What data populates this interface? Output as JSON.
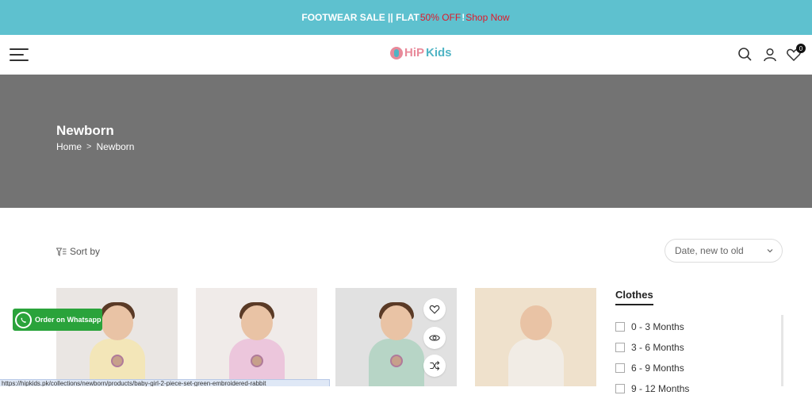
{
  "announcement": {
    "text_a": "FOOTWEAR SALE || FLAT ",
    "highlight": "50% OFF",
    "text_b": " ! ",
    "link": "Shop Now"
  },
  "header": {
    "logo_a": "HiP",
    "logo_b": "Kids",
    "cart_count": "0"
  },
  "hero": {
    "title": "Newborn",
    "breadcrumb": [
      "Home",
      ">",
      "Newborn"
    ]
  },
  "toolbar": {
    "sort_label": "Sort by",
    "sort_value": "Date, new to old"
  },
  "products": [
    {
      "bg": "#eae6e3",
      "dress": "#f3e6b8"
    },
    {
      "bg": "#f0ebe9",
      "dress": "#ecc6dc"
    },
    {
      "bg": "#e1e1e1",
      "dress": "#b7d5c6"
    },
    {
      "bg": "#efe1cc",
      "dress": "#f1ece5"
    }
  ],
  "filters": {
    "title": "Clothes",
    "options": [
      "0 - 3 Months",
      "3 - 6 Months",
      "6 - 9 Months",
      "9 - 12 Months"
    ]
  },
  "whatsapp": {
    "label": "Order on Whatsapp"
  },
  "status_url": "https://hipkids.pk/collections/newborn/products/baby-girl-2-piece-set-green-embroidered-rabbit",
  "colors": {
    "accent": "#5ec1cf",
    "sale": "#e0192a",
    "hero_bg": "#737373",
    "whatsapp": "#2aa33b"
  }
}
